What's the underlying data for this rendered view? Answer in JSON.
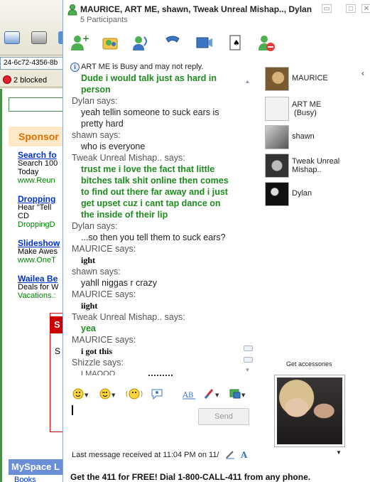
{
  "background_browser": {
    "address_text": "24-6c72-4356-8b",
    "blocked_text": "2 blocked",
    "sponsored_label": "Sponsor",
    "ads": [
      {
        "title": "Search fo",
        "desc1": "Search 100",
        "desc2": "Today",
        "url": "www.Reun"
      },
      {
        "title": "Dropping",
        "desc1": "Hear \"Tell",
        "desc2": "CD",
        "url": "DroppingD"
      },
      {
        "title": "Slideshow",
        "desc1": "Make Awes",
        "desc2": "",
        "url": "www.OneT"
      },
      {
        "title": "Wailea Be",
        "desc1": "Deals for W",
        "desc2": "",
        "url": "Vacations.:"
      }
    ],
    "red_box_s1": "S",
    "red_box_s2": "S",
    "myspace_label": "MySpace L",
    "books_label": "Books"
  },
  "chat": {
    "title": "MAURICE, ART ME, shawn, Tweak Unreal Mishap.., Dylan",
    "participants_count": "5 Participants",
    "toolbar_buttons": [
      "invite-icon",
      "share-files-icon",
      "voice-call-icon",
      "phone-icon",
      "video-icon",
      "games-icon",
      "block-icon"
    ],
    "notice": "ART ME is Busy and may not reply.",
    "messages": [
      {
        "who_line": "",
        "lines": [
          "Dude i would talk just as hard in",
          "person"
        ],
        "style": "green"
      },
      {
        "who_line": "Dylan says:",
        "lines": [
          "yeah tellin someone to suck ears is",
          "pretty hard"
        ],
        "style": "plain"
      },
      {
        "who_line": "shawn says:",
        "lines": [
          "who is everyone"
        ],
        "style": "plain"
      },
      {
        "who_line": "Tweak Unreal Mishap.. says:",
        "lines": [
          "trust me i love the fact that little",
          "bitches talk shit online then comes",
          "to find out there far away and i just",
          "get upset cuz i cant tap dance on",
          "the inside of their lip"
        ],
        "style": "green"
      },
      {
        "who_line": "Dylan says:",
        "lines": [
          "...so then you tell them to suck ears?"
        ],
        "style": "plain"
      },
      {
        "who_line": "MAURICE says:",
        "lines": [
          "ight"
        ],
        "style": "serif"
      },
      {
        "who_line": "shawn says:",
        "lines": [
          "yahll niggas r crazy"
        ],
        "style": "plain"
      },
      {
        "who_line": "MAURICE says:",
        "lines": [
          "iight"
        ],
        "style": "serif"
      },
      {
        "who_line": "Tweak Unreal Mishap.. says:",
        "lines": [
          "yea"
        ],
        "style": "green"
      },
      {
        "who_line": "MAURICE says:",
        "lines": [
          "i got this"
        ],
        "style": "serif"
      },
      {
        "who_line": "Shizzle says:",
        "lines": [
          "LMAOOO"
        ],
        "style": "small"
      }
    ],
    "participants": [
      {
        "name": "MAURICE",
        "status": "",
        "pic_color": "#b08040"
      },
      {
        "name": "ART ME",
        "status": " (Busy)",
        "pic_color": "#d9d9d9"
      },
      {
        "name": "shawn",
        "status": "",
        "pic_color": "#8a8a8a"
      },
      {
        "name": "Tweak Unreal",
        "status": "Mishap..",
        "pic_color": "#606060"
      },
      {
        "name": "Dylan",
        "status": "",
        "pic_color": "#202020"
      }
    ],
    "format_buttons": [
      "emoticon-icon",
      "wink-icon",
      "nudge-icon",
      "voice-clip-icon",
      "font-icon",
      "background-icon",
      "other-icon"
    ],
    "send_label": "Send",
    "status_line": "Last message received at 11:04 PM on 11/",
    "accessories_label": "Get accessories",
    "footer": "Get the 411 for FREE!  Dial 1-800-CALL-411 from any phone."
  }
}
